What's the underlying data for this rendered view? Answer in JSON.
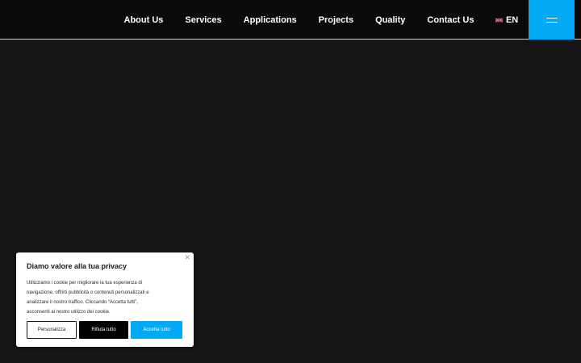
{
  "header": {
    "nav": [
      {
        "label": "About Us"
      },
      {
        "label": "Services"
      },
      {
        "label": "Applications"
      },
      {
        "label": "Projects"
      },
      {
        "label": "Quality"
      },
      {
        "label": "Contact Us"
      }
    ],
    "language": {
      "label": "EN",
      "flag_icon": "uk-flag-icon"
    },
    "menu_icon": "hamburger-menu-icon",
    "accent_color": "#03a9f4"
  },
  "cookie_banner": {
    "close_icon": "close-icon",
    "title": "Diamo valore alla tua privacy",
    "text_lines": [
      "Utilizziamo i cookie per migliorare la tua esperienza di",
      "navigazione, offrirti pubblicità o contenuti personalizzati e",
      "analizzare il nostro traffico. Cliccando “Accetta tutti”,",
      "acconsenti al nostro utilizzo dei cookie."
    ],
    "buttons": {
      "customize": "Personalizza",
      "reject": "Rifiuta tutto",
      "accept": "Accetta tutto"
    }
  }
}
